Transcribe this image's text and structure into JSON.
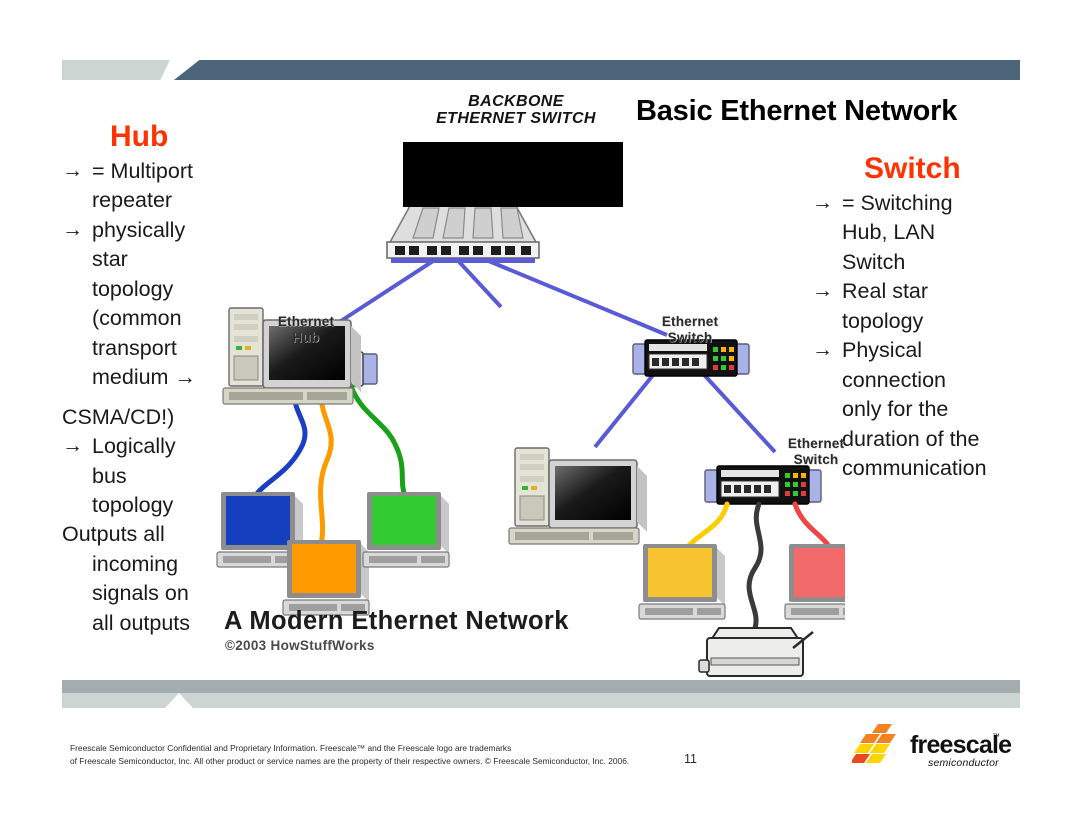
{
  "slide": {
    "title": "Basic Ethernet Network",
    "page_number": "11",
    "accent_red": "#ff3300",
    "bar_dark": "#4d657a",
    "bar_light": "#ccd5d2",
    "bar_gray": "#a3acae"
  },
  "hub_column": {
    "heading": "Hub",
    "bullets": [
      {
        "arrow": "→",
        "text": "= Multiport repeater"
      },
      {
        "arrow": "→",
        "text": "physically star topology (common transport medium →"
      },
      {
        "arrow": "",
        "text": "CSMA/CD!)"
      },
      {
        "arrow": "→",
        "text": "Logically bus topology"
      },
      {
        "arrow": "",
        "text": "Outputs all incoming signals on all outputs"
      }
    ],
    "lines": [
      "= Multiport",
      "repeater",
      "physically",
      "star",
      "topology",
      "(common",
      "transport",
      "medium →",
      "CSMA/CD!)",
      "Logically",
      "bus",
      "topology",
      "Outputs all",
      "incoming",
      "signals on",
      "all outputs"
    ]
  },
  "switch_column": {
    "heading": "Switch",
    "bullets": [
      {
        "arrow": "→",
        "text": "= Switching Hub, LAN Switch"
      },
      {
        "arrow": "→",
        "text": "Real star topology"
      },
      {
        "arrow": "→",
        "text": "Physical connection only for the duration of the communication"
      }
    ],
    "lines": [
      "= Switching",
      "Hub, LAN",
      "Switch",
      "Real star",
      "topology",
      "Physical",
      "connection",
      "only for the",
      "duration of the",
      "communication"
    ]
  },
  "diagram": {
    "title": "A Modern Ethernet Network",
    "copyright": "©2003 HowStuffWorks",
    "backbone_label_line1": "BACKBONE",
    "backbone_label_line2": "ETHERNET SWITCH",
    "labels": {
      "ethernet_hub": "Ethernet\nHub",
      "ethernet_hub_l1": "Ethernet",
      "ethernet_hub_l2": "Hub",
      "ethernet_switch_l1": "Ethernet",
      "ethernet_switch_l2": "Switch"
    },
    "node_colors": {
      "backbone_link": "#5a5ad6",
      "hub_link_blue": "#1a3fc4",
      "hub_link_orange": "#ff9900",
      "hub_link_green": "#1aa11a",
      "switch_link_yellow": "#ffcc00",
      "switch_link_black": "#3a3a3a",
      "switch_link_red": "#f04545",
      "monitor_blue": "#1440c0",
      "monitor_orange": "#ff9900",
      "monitor_green": "#33cc33",
      "monitor_yellow": "#f7c331",
      "monitor_red": "#f26a6a",
      "redaction": "#000000"
    }
  },
  "footer": {
    "legal_line1": "Freescale Semiconductor Confidential and Proprietary Information. Freescale™ and the Freescale logo are trademarks",
    "legal_line2": "of Freescale Semiconductor, Inc. All other product or service names are the property of their respective owners. © Freescale Semiconductor, Inc. 2006.",
    "page_number": "11"
  },
  "brand": {
    "name": "freescale",
    "tm": "™",
    "tagline": "semiconductor",
    "logo_colors": [
      "#f58220",
      "#ffd400",
      "#e8491e"
    ]
  }
}
